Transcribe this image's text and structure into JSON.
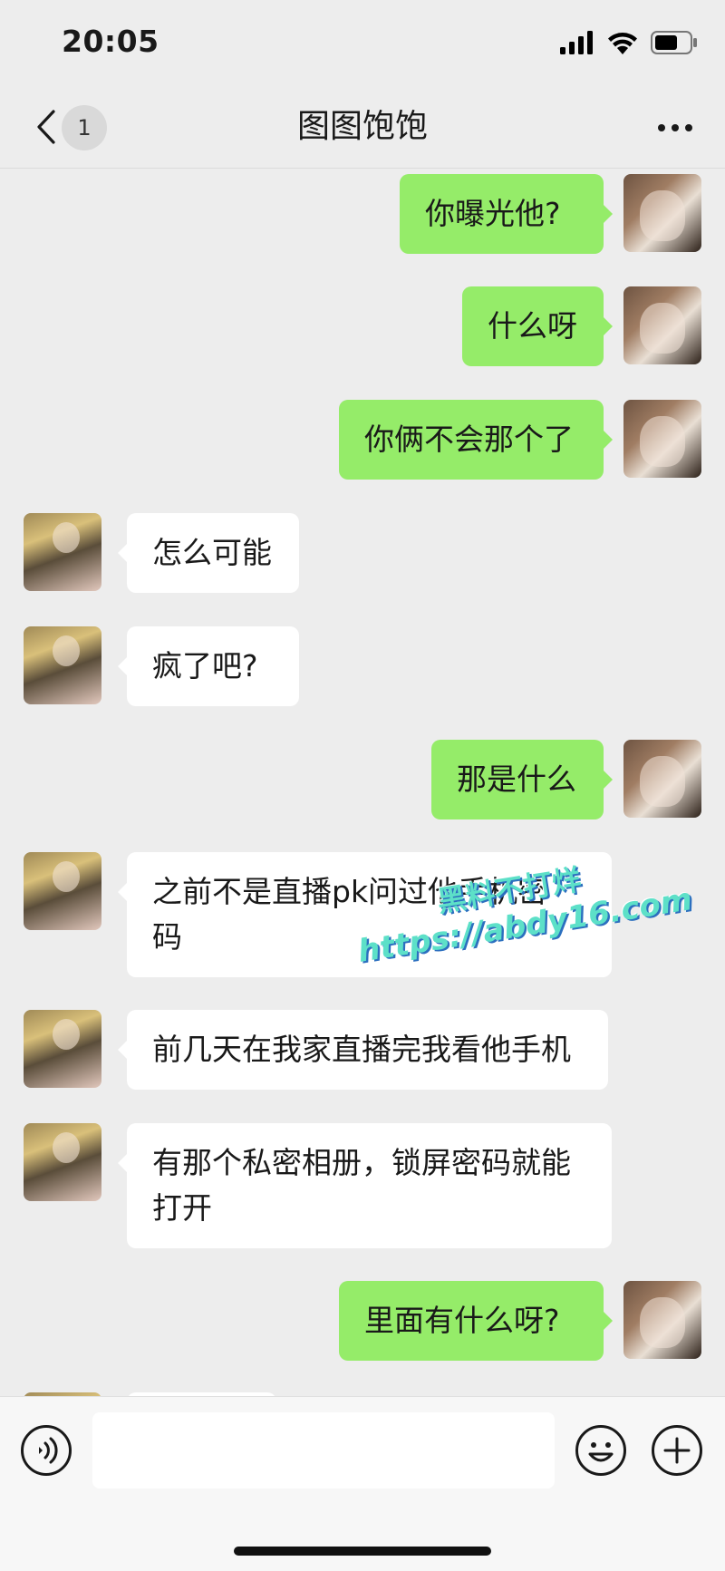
{
  "status_bar": {
    "time": "20:05"
  },
  "header": {
    "title": "图图饱饱",
    "unread_count": "1"
  },
  "messages": [
    {
      "from": "me",
      "text": "你曝光他?"
    },
    {
      "from": "me",
      "text": "什么呀"
    },
    {
      "from": "me",
      "text": "你俩不会那个了"
    },
    {
      "from": "other",
      "text": "怎么可能"
    },
    {
      "from": "other",
      "text": "疯了吧?"
    },
    {
      "from": "me",
      "text": "那是什么"
    },
    {
      "from": "other",
      "text": "之前不是直播pk问过他手机密\n码"
    },
    {
      "from": "other",
      "text": "前几天在我家直播完我看他手机"
    },
    {
      "from": "other",
      "text": "有那个私密相册，锁屏密码就能\n打开"
    },
    {
      "from": "me",
      "text": "里面有什么呀?"
    }
  ],
  "watermark": {
    "line1": "黑料不打烊",
    "line2": "https://abdy16.com"
  },
  "input_bar": {
    "value": ""
  },
  "colors": {
    "background": "#ededed",
    "my_bubble": "#95ec69",
    "other_bubble": "#ffffff"
  },
  "icons": [
    "signal-icon",
    "wifi-icon",
    "battery-icon",
    "back-icon",
    "more-icon",
    "voice-icon",
    "emoji-icon",
    "plus-icon"
  ]
}
